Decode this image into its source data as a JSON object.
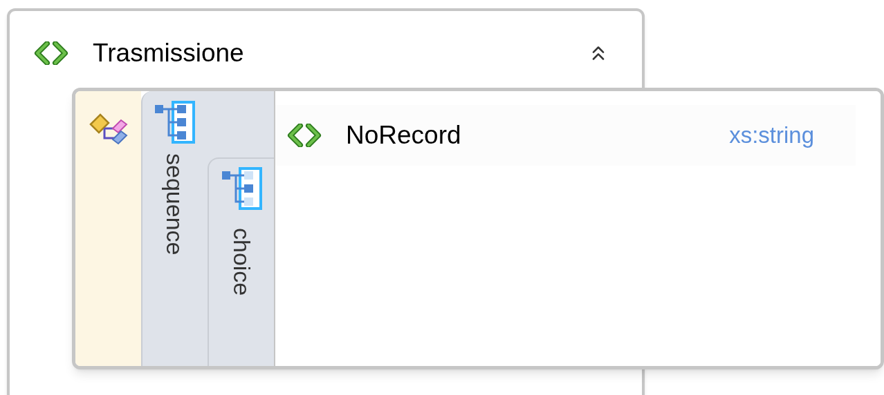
{
  "element": {
    "name": "Trasmissione",
    "expanded": true,
    "sequence": {
      "label": "sequence",
      "choice": {
        "label": "choice",
        "elements": [
          {
            "name": "NoRecord",
            "type": "xs:string"
          }
        ]
      }
    }
  }
}
